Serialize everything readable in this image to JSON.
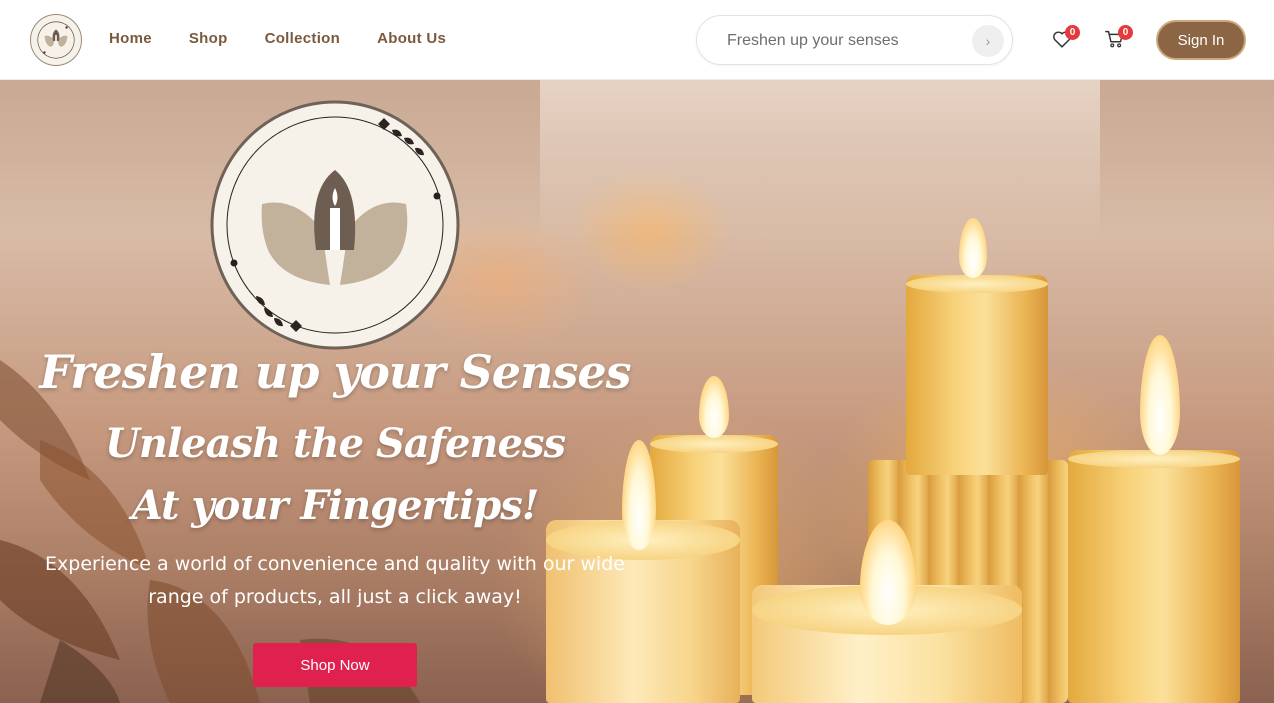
{
  "nav": {
    "links": [
      "Home",
      "Shop",
      "Collection",
      "About Us"
    ],
    "search_placeholder": "Freshen up your senses",
    "wishlist_count": "0",
    "cart_count": "0",
    "signin_label": "Sign In"
  },
  "hero": {
    "title_line1": "Freshen up your Senses",
    "title_line2": "Unleash the Safeness",
    "title_line3": "At your Fingertips!",
    "description": "Experience a world of convenience and quality with our wide range of products, all just a click away!",
    "cta_label": "Shop Now"
  },
  "colors": {
    "brand_brown": "#8c6545",
    "nav_text": "#7a5a3c",
    "cta_red": "#e0214f",
    "badge_red": "#e5393c"
  },
  "icons": [
    "logo",
    "chevron-right-icon",
    "heart-icon",
    "cart-icon"
  ]
}
